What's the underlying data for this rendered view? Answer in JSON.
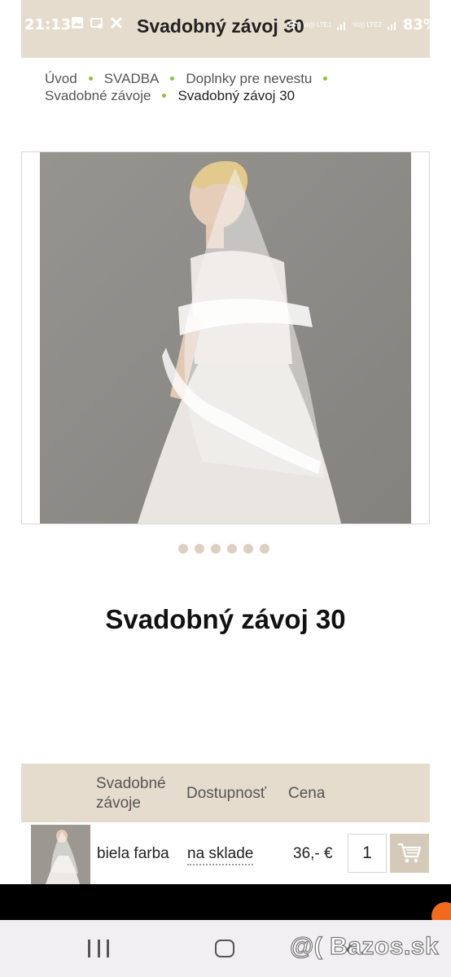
{
  "status_bar": {
    "time": "21:13",
    "battery": "83%",
    "network_labels": [
      "Vo)) LTE1",
      "Vo)) LTE2"
    ]
  },
  "header": {
    "title": "Svadobný závoj 30"
  },
  "breadcrumb": {
    "items": [
      "Úvod",
      "SVADBA",
      "Doplnky pre nevestu",
      "Svadobné závoje",
      "Svadobný závoj 30"
    ]
  },
  "carousel": {
    "dot_count": 6
  },
  "product": {
    "title": "Svadobný závoj 30"
  },
  "variants_table": {
    "headers": {
      "name": "Svadobné závoje",
      "availability": "Dostupnosť",
      "price": "Cena"
    },
    "rows": [
      {
        "name": "biela farba",
        "availability": "na sklade",
        "price": "36,- €",
        "quantity": "1"
      }
    ]
  },
  "watermark": "@( Bazos.sk",
  "colors": {
    "band": "#e6dccd",
    "breadcrumb_dot": "#8fc23a",
    "cart_button": "#d5cab9",
    "fab": "#f26a1b"
  }
}
